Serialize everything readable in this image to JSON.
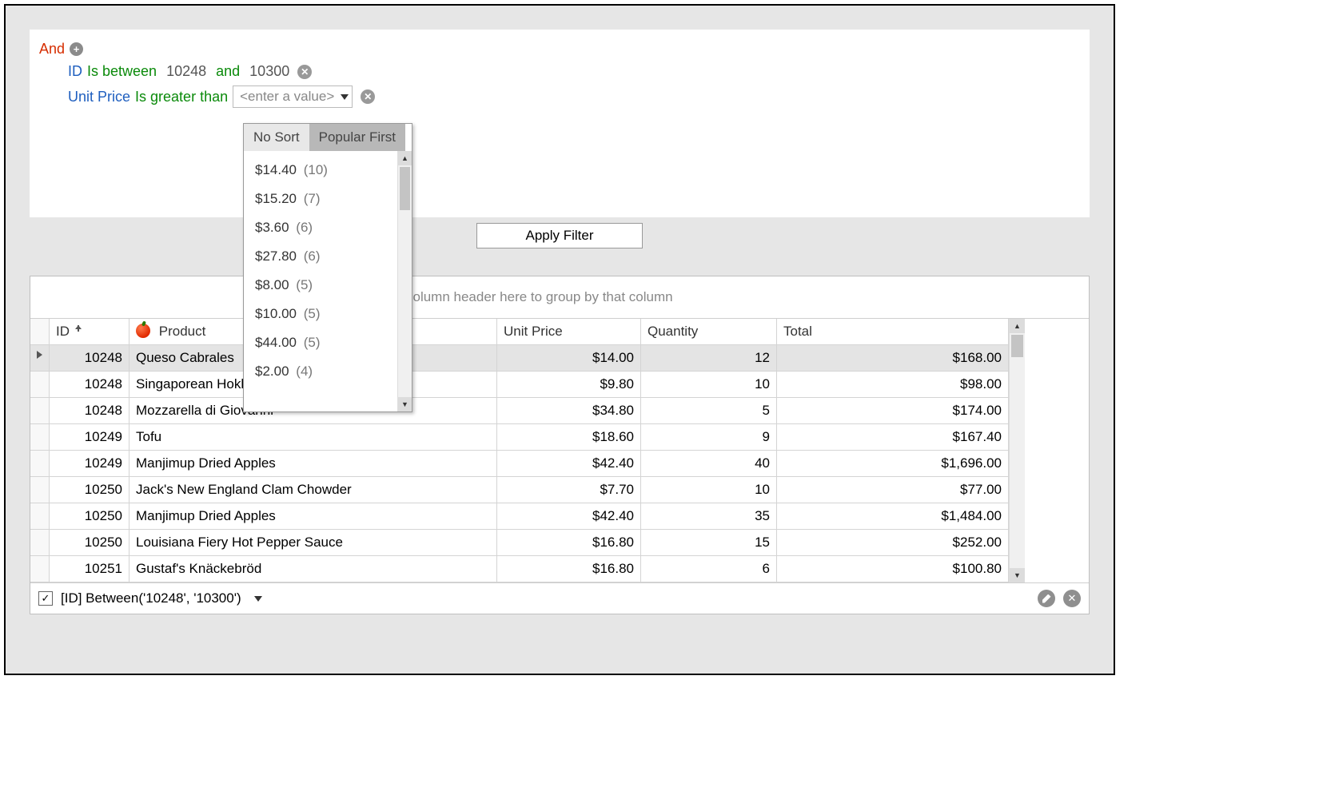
{
  "filter": {
    "root": "And",
    "rows": [
      {
        "field": "ID",
        "op": "Is between",
        "v1": "10248",
        "join": "and",
        "v2": "10300"
      },
      {
        "field": "Unit Price",
        "op": "Is greater than",
        "placeholder": "<enter a value>"
      }
    ]
  },
  "dropdown": {
    "tabs": [
      "No Sort",
      "Popular First"
    ],
    "selected": 1,
    "items": [
      {
        "value": "$14.40",
        "count": "(10)"
      },
      {
        "value": "$15.20",
        "count": "(7)"
      },
      {
        "value": "$3.60",
        "count": "(6)"
      },
      {
        "value": "$27.80",
        "count": "(6)"
      },
      {
        "value": "$8.00",
        "count": "(5)"
      },
      {
        "value": "$10.00",
        "count": "(5)"
      },
      {
        "value": "$44.00",
        "count": "(5)"
      },
      {
        "value": "$2.00",
        "count": "(4)"
      }
    ]
  },
  "apply": "Apply Filter",
  "group_bar": "column header here to group by that column",
  "columns": {
    "id": "ID",
    "product": "Product",
    "unit": "Unit Price",
    "qty": "Quantity",
    "total": "Total"
  },
  "rows": [
    {
      "id": "10248",
      "product": "Queso Cabrales",
      "unit": "$14.00",
      "qty": "12",
      "total": "$168.00",
      "selected": true
    },
    {
      "id": "10248",
      "product": "Singaporean Hokkien Fried Mee",
      "unit": "$9.80",
      "qty": "10",
      "total": "$98.00"
    },
    {
      "id": "10248",
      "product": "Mozzarella di Giovanni",
      "unit": "$34.80",
      "qty": "5",
      "total": "$174.00"
    },
    {
      "id": "10249",
      "product": "Tofu",
      "unit": "$18.60",
      "qty": "9",
      "total": "$167.40"
    },
    {
      "id": "10249",
      "product": "Manjimup Dried Apples",
      "unit": "$42.40",
      "qty": "40",
      "total": "$1,696.00"
    },
    {
      "id": "10250",
      "product": "Jack's New England Clam Chowder",
      "unit": "$7.70",
      "qty": "10",
      "total": "$77.00"
    },
    {
      "id": "10250",
      "product": "Manjimup Dried Apples",
      "unit": "$42.40",
      "qty": "35",
      "total": "$1,484.00"
    },
    {
      "id": "10250",
      "product": "Louisiana Fiery Hot Pepper Sauce",
      "unit": "$16.80",
      "qty": "15",
      "total": "$252.00"
    },
    {
      "id": "10251",
      "product": "Gustaf's Knäckebröd",
      "unit": "$16.80",
      "qty": "6",
      "total": "$100.80"
    }
  ],
  "footer": {
    "expression": "[ID] Between('10248', '10300')",
    "checked": true
  }
}
